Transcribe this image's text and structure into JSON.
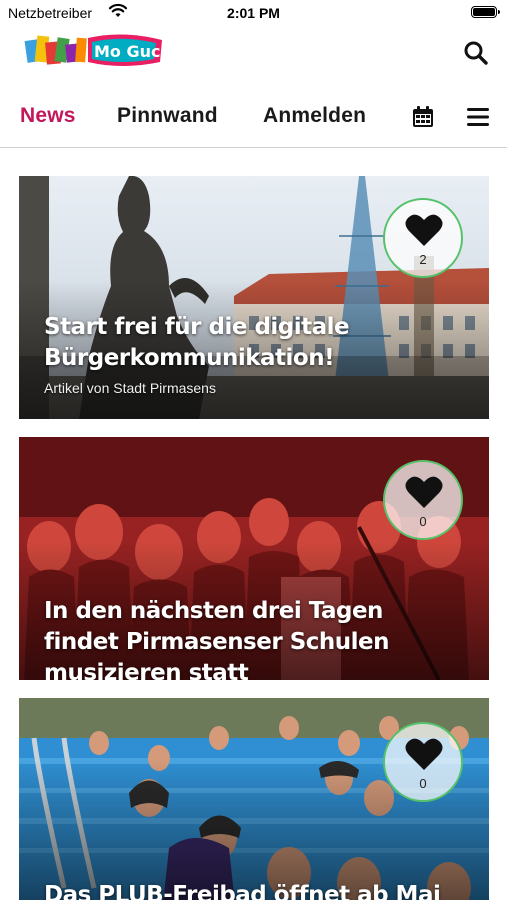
{
  "status_bar": {
    "carrier": "Netzbetreiber",
    "time": "2:01 PM"
  },
  "header": {
    "logo_text": "Mo Gucge!",
    "search_icon": "search-icon"
  },
  "nav": {
    "tabs": [
      {
        "label": "News",
        "active": true
      },
      {
        "label": "Pinnwand",
        "active": false
      },
      {
        "label": "Anmelden",
        "active": false
      }
    ],
    "calendar_icon": "calendar-icon",
    "menu_icon": "hamburger-menu-icon",
    "accent_color": "#c2185b"
  },
  "cards": [
    {
      "title": "Start frei für die digitale Bürgerkommunikation!",
      "byline": "Artikel von Stadt Pirmasens",
      "likes": "2"
    },
    {
      "title": "In den nächsten drei Tagen findet Pirmasenser Schulen musizieren statt",
      "byline": "",
      "likes": "0"
    },
    {
      "title": "Das PLUB-Freibad öffnet ab Mai",
      "byline": "",
      "likes": "0"
    }
  ],
  "like_ring_color": "#55c26a"
}
